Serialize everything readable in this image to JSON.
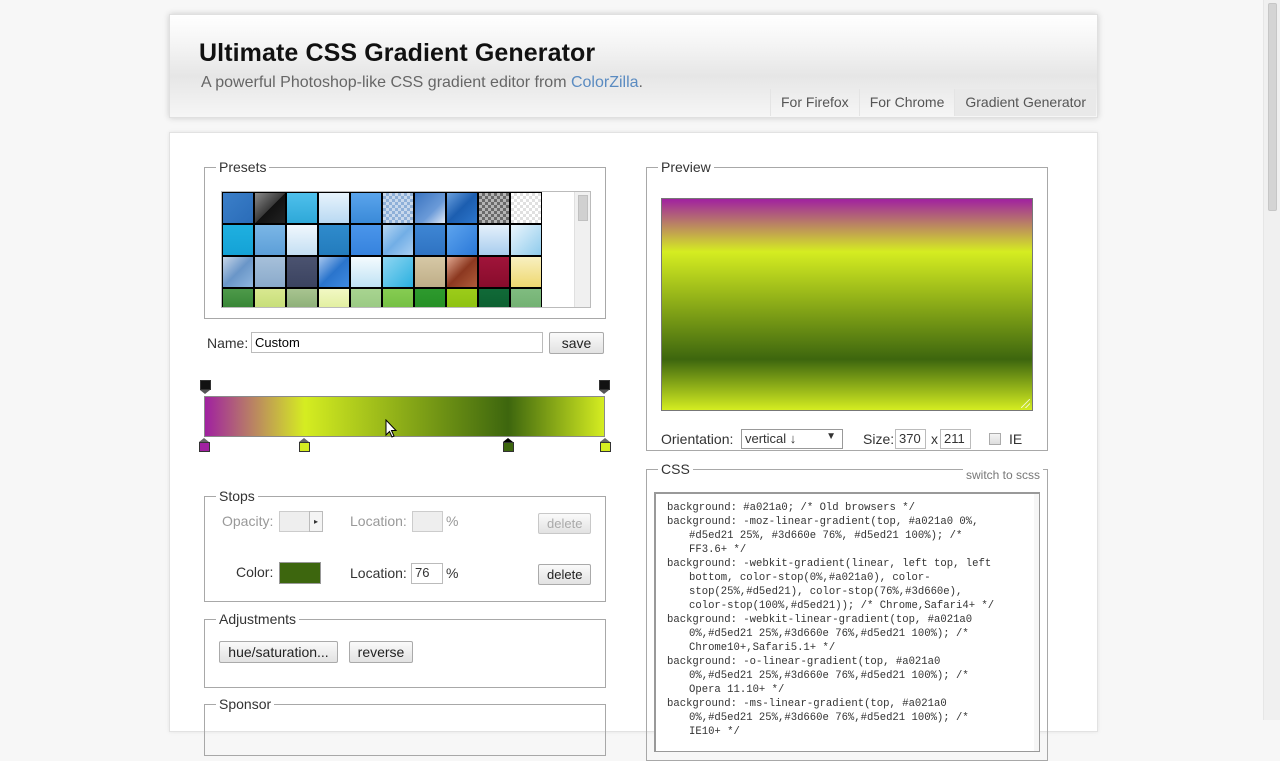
{
  "header": {
    "title": "Ultimate CSS Gradient Generator",
    "subtitle_prefix": "A powerful Photoshop-like CSS gradient editor from ",
    "subtitle_link": "ColorZilla",
    "subtitle_suffix": ".",
    "nav": [
      {
        "label": "For Firefox",
        "active": false
      },
      {
        "label": "For Chrome",
        "active": false
      },
      {
        "label": "Gradient Generator",
        "active": true
      }
    ]
  },
  "presets": {
    "legend": "Presets",
    "swatches": [
      "linear-gradient(135deg,#3b7fc9,#2a6cb8)",
      "linear-gradient(135deg,#8a8a8a 0%,#3a3a3a 50%,#111 51%,#222 100%)",
      "linear-gradient(#4fc0ec,#2ea8d8)",
      "linear-gradient(#e7f3fc,#b9d9f2)",
      "linear-gradient(#5aa4ec,#3a8ad8)",
      "repeating-conic-gradient(#8fb0d8 0 25%,#c8d8ec 0 50%) 0 0/6px 6px",
      "linear-gradient(135deg,#3b74c0,#6a9ad8 60%,#dfe9f7)",
      "linear-gradient(135deg,#6aa0de,#1c5eb0 50%,#2d76cc)",
      "repeating-conic-gradient(#6a6a6a 0 25%,#b4b4b4 0 50%) 0 0/6px 6px",
      "repeating-conic-gradient(#e0e0e0 0 25%,#fff 0 50%) 0 0/6px 6px",
      "linear-gradient(#1fb0e0,#14a2d6)",
      "linear-gradient(#7ab6e6,#5d9fd8)",
      "linear-gradient(#f0f7fd,#c4dff3)",
      "linear-gradient(#2f8bcc,#237cbd)",
      "linear-gradient(#4a95ea,#3683de)",
      "linear-gradient(135deg,#b6d6f4,#72aee6 50%,#a9cff3)",
      "linear-gradient(#3e86d4,#2f73c2)",
      "linear-gradient(135deg,#5da4ee,#2a78d8)",
      "linear-gradient(#e4f0fb,#a8cdee)",
      "linear-gradient(135deg,#eaf5fd,#8fcbec)",
      "linear-gradient(135deg,#c7d6e8,#6a96c8 50%,#8fb6de)",
      "linear-gradient(#a6c0da,#8aaacb)",
      "linear-gradient(#4b5370,#3b4360)",
      "linear-gradient(135deg,#a6c6ee,#2a74cc 50%,#3f8ae0)",
      "linear-gradient(#f4fbfe,#bfe2f4)",
      "linear-gradient(135deg,#8fd6f2,#2ab0e0)",
      "linear-gradient(#d6c8a6,#bfae88)",
      "linear-gradient(135deg,#e0a890,#8c3820 50%,#b05c3a)",
      "linear-gradient(#a0143a,#880c2c)",
      "linear-gradient(#f8f0c0,#efd870)",
      "linear-gradient(#4e9a4a,#2a7a2a)",
      "linear-gradient(#d8e890,#bcd86a)",
      "linear-gradient(#a8c490,#7ea46a)",
      "linear-gradient(#f2f8c4,#d8ea8a)",
      "linear-gradient(#a8d490,#92c47c)",
      "linear-gradient(#86cc52,#6ab83a)",
      "linear-gradient(#2e9a2e,#208a20)",
      "linear-gradient(#9ccc1a,#86bc0c)",
      "linear-gradient(#116a38,#0a5a2c)",
      "linear-gradient(#80bc80,#6aaa6a)"
    ]
  },
  "name": {
    "label": "Name:",
    "value": "Custom",
    "save_label": "save"
  },
  "gradient": {
    "stops": [
      {
        "color": "#a021a0",
        "location": 0
      },
      {
        "color": "#d5ed21",
        "location": 25
      },
      {
        "color": "#3d660e",
        "location": 76
      },
      {
        "color": "#d5ed21",
        "location": 100
      }
    ],
    "opacity_stops": [
      0,
      100
    ],
    "selected_stop": 2
  },
  "stops_panel": {
    "legend": "Stops",
    "opacity_label": "Opacity:",
    "opacity_value": "",
    "location_label": "Location:",
    "opacity_location_value": "",
    "percent": "%",
    "delete_label": "delete",
    "color_label": "Color:",
    "color_value": "#3d660e",
    "color_location_value": "76"
  },
  "adjustments": {
    "legend": "Adjustments",
    "hue_label": "hue/saturation...",
    "reverse_label": "reverse"
  },
  "sponsor": {
    "legend": "Sponsor"
  },
  "preview": {
    "legend": "Preview",
    "orientation_label": "Orientation:",
    "orientation_value": "vertical ↓",
    "size_label": "Size:",
    "width_value": "370",
    "x_label": "x",
    "height_value": "211",
    "ie_label": "IE",
    "ie_checked": false
  },
  "css": {
    "legend": "CSS",
    "switch_label": "switch to scss",
    "lines": [
      {
        "text": "background: #a021a0; /* Old browsers */",
        "indent": false
      },
      {
        "text": "background: -moz-linear-gradient(top, #a021a0 0%,",
        "indent": false
      },
      {
        "text": "#d5ed21 25%, #3d660e 76%, #d5ed21 100%); /*",
        "indent": true
      },
      {
        "text": "FF3.6+ */",
        "indent": true
      },
      {
        "text": "background: -webkit-gradient(linear, left top, left",
        "indent": false
      },
      {
        "text": "bottom, color-stop(0%,#a021a0), color-",
        "indent": true
      },
      {
        "text": "stop(25%,#d5ed21), color-stop(76%,#3d660e),",
        "indent": true
      },
      {
        "text": "color-stop(100%,#d5ed21)); /* Chrome,Safari4+ */",
        "indent": true
      },
      {
        "text": "background: -webkit-linear-gradient(top, #a021a0",
        "indent": false
      },
      {
        "text": "0%,#d5ed21 25%,#3d660e 76%,#d5ed21 100%); /*",
        "indent": true
      },
      {
        "text": "Chrome10+,Safari5.1+ */",
        "indent": true
      },
      {
        "text": "background: -o-linear-gradient(top, #a021a0",
        "indent": false
      },
      {
        "text": "0%,#d5ed21 25%,#3d660e 76%,#d5ed21 100%); /*",
        "indent": true
      },
      {
        "text": "Opera 11.10+ */",
        "indent": true
      },
      {
        "text": "background: -ms-linear-gradient(top, #a021a0",
        "indent": false
      },
      {
        "text": "0%,#d5ed21 25%,#3d660e 76%,#d5ed21 100%); /*",
        "indent": true
      },
      {
        "text": "IE10+ */",
        "indent": true
      }
    ]
  }
}
